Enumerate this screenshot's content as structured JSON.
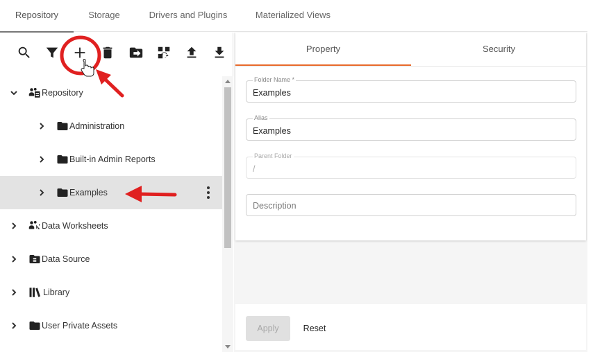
{
  "top_tabs": [
    "Repository",
    "Storage",
    "Drivers and Plugins",
    "Materialized Views"
  ],
  "toolbar_icons": [
    "search-icon",
    "filter-icon",
    "add-icon",
    "delete-icon",
    "move-icon",
    "replace-icon",
    "upload-icon",
    "download-icon"
  ],
  "tree": {
    "repository": "Repository",
    "administration": "Administration",
    "builtin_reports": "Built-in Admin Reports",
    "examples": "Examples",
    "data_worksheets": "Data Worksheets",
    "data_source": "Data Source",
    "library": "Library",
    "user_private_assets": "User Private Assets"
  },
  "sub_tabs": [
    "Property",
    "Security"
  ],
  "form": {
    "folder_name_label": "Folder Name *",
    "folder_name_value": "Examples",
    "alias_label": "Alias",
    "alias_value": "Examples",
    "parent_folder_label": "Parent Folder",
    "parent_folder_value": "/",
    "description_placeholder": "Description"
  },
  "footer": {
    "apply_label": "Apply",
    "reset_label": "Reset"
  },
  "colors": {
    "accent": "#e8692a",
    "annotation": "#e02020",
    "selected_row": "#e3e3e3"
  }
}
